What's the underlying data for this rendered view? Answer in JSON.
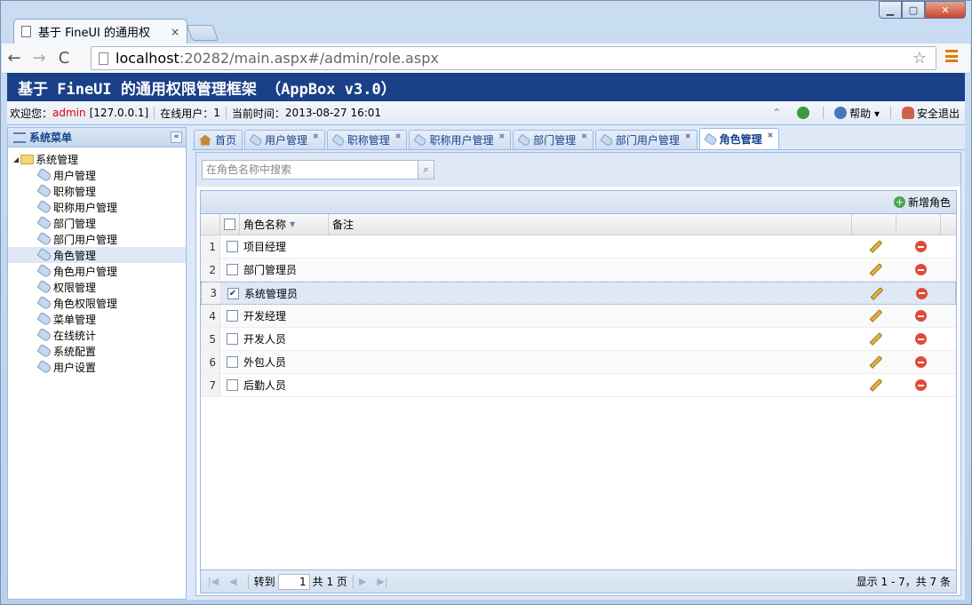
{
  "browser": {
    "tab_title": "基于 FineUI 的通用权",
    "tab_close": "×",
    "url_host": "localhost",
    "url_rest": ":20282/main.aspx#/admin/role.aspx",
    "back": "←",
    "forward": "→",
    "reload": "C",
    "star": "☆",
    "min": "▁",
    "max": "▢",
    "close": "✕"
  },
  "app": {
    "header_title": "基于 FineUI 的通用权限管理框架 （AppBox v3.0）",
    "info": {
      "welcome": "欢迎您：",
      "user": "admin",
      "ip": "[127.0.0.1]",
      "online_label": "在线用户：",
      "online_count": "1",
      "time_label": "当前时间：",
      "time": "2013-08-27 16:01",
      "help": "帮助 ▾",
      "logout": "安全退出"
    }
  },
  "sidebar": {
    "title": "系统菜单",
    "collapse": "«",
    "root": "系统管理",
    "items": [
      "用户管理",
      "职称管理",
      "职称用户管理",
      "部门管理",
      "部门用户管理",
      "角色管理",
      "角色用户管理",
      "权限管理",
      "角色权限管理",
      "菜单管理",
      "在线统计",
      "系统配置",
      "用户设置"
    ],
    "selected_index": 5
  },
  "tabs": [
    {
      "label": "首页",
      "closable": false
    },
    {
      "label": "用户管理",
      "closable": true
    },
    {
      "label": "职称管理",
      "closable": true
    },
    {
      "label": "职称用户管理",
      "closable": true
    },
    {
      "label": "部门管理",
      "closable": true
    },
    {
      "label": "部门用户管理",
      "closable": true
    },
    {
      "label": "角色管理",
      "closable": true,
      "active": true
    }
  ],
  "search": {
    "placeholder": "在角色名称中搜索"
  },
  "grid": {
    "add_button": "新增角色",
    "columns": {
      "name": "角色名称",
      "note": "备注"
    },
    "rows": [
      {
        "num": "1",
        "name": "项目经理",
        "note": "",
        "checked": false
      },
      {
        "num": "2",
        "name": "部门管理员",
        "note": "",
        "checked": false
      },
      {
        "num": "3",
        "name": "系统管理员",
        "note": "",
        "checked": true
      },
      {
        "num": "4",
        "name": "开发经理",
        "note": "",
        "checked": false
      },
      {
        "num": "5",
        "name": "开发人员",
        "note": "",
        "checked": false
      },
      {
        "num": "6",
        "name": "外包人员",
        "note": "",
        "checked": false
      },
      {
        "num": "7",
        "name": "后勤人员",
        "note": "",
        "checked": false
      }
    ]
  },
  "pager": {
    "goto": "转到",
    "page": "1",
    "total_pages": "共 1 页",
    "summary": "显示 1 - 7，共 7 条"
  }
}
